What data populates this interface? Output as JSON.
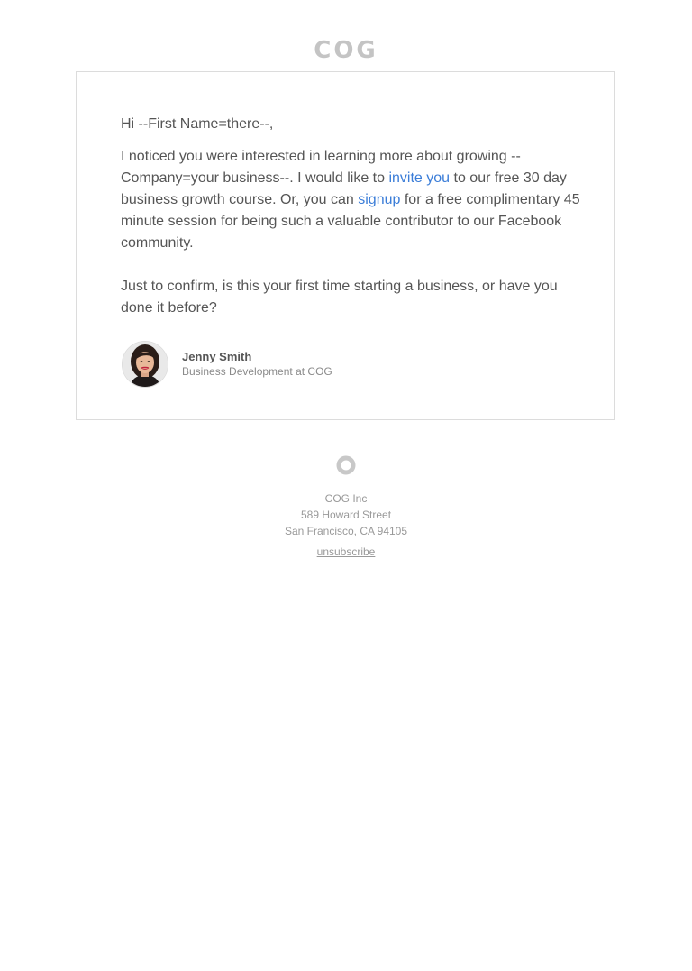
{
  "header": {
    "logo_text": "COG"
  },
  "email": {
    "greeting": "Hi --First Name=there--,",
    "paragraph1": {
      "part1": "I noticed you were interested in learning more about growing --Company=your business--. I would like to ",
      "link1_label": "invite you",
      "part2": " to our free 30 day business growth course. Or, you can ",
      "link2_label": "signup",
      "part3": " for a free complimentary 45 minute session for being such a valuable contributor to our Facebook community."
    },
    "paragraph2": "Just to confirm, is this your first time starting a business, or have you done it before?",
    "signature": {
      "name": "Jenny Smith",
      "role": "Business Development at COG"
    }
  },
  "footer": {
    "company": "COG Inc",
    "street": "589 Howard Street",
    "city": "San Francisco, CA 94105",
    "unsubscribe_label": "unsubscribe"
  },
  "colors": {
    "link": "#3b7dd8",
    "body_text": "#555555",
    "muted": "#999999",
    "logo": "#c4c4c4",
    "border": "#dcdcdc"
  },
  "icons": {
    "footer_mark": "ring-logo-icon",
    "avatar": "user-avatar-photo"
  }
}
